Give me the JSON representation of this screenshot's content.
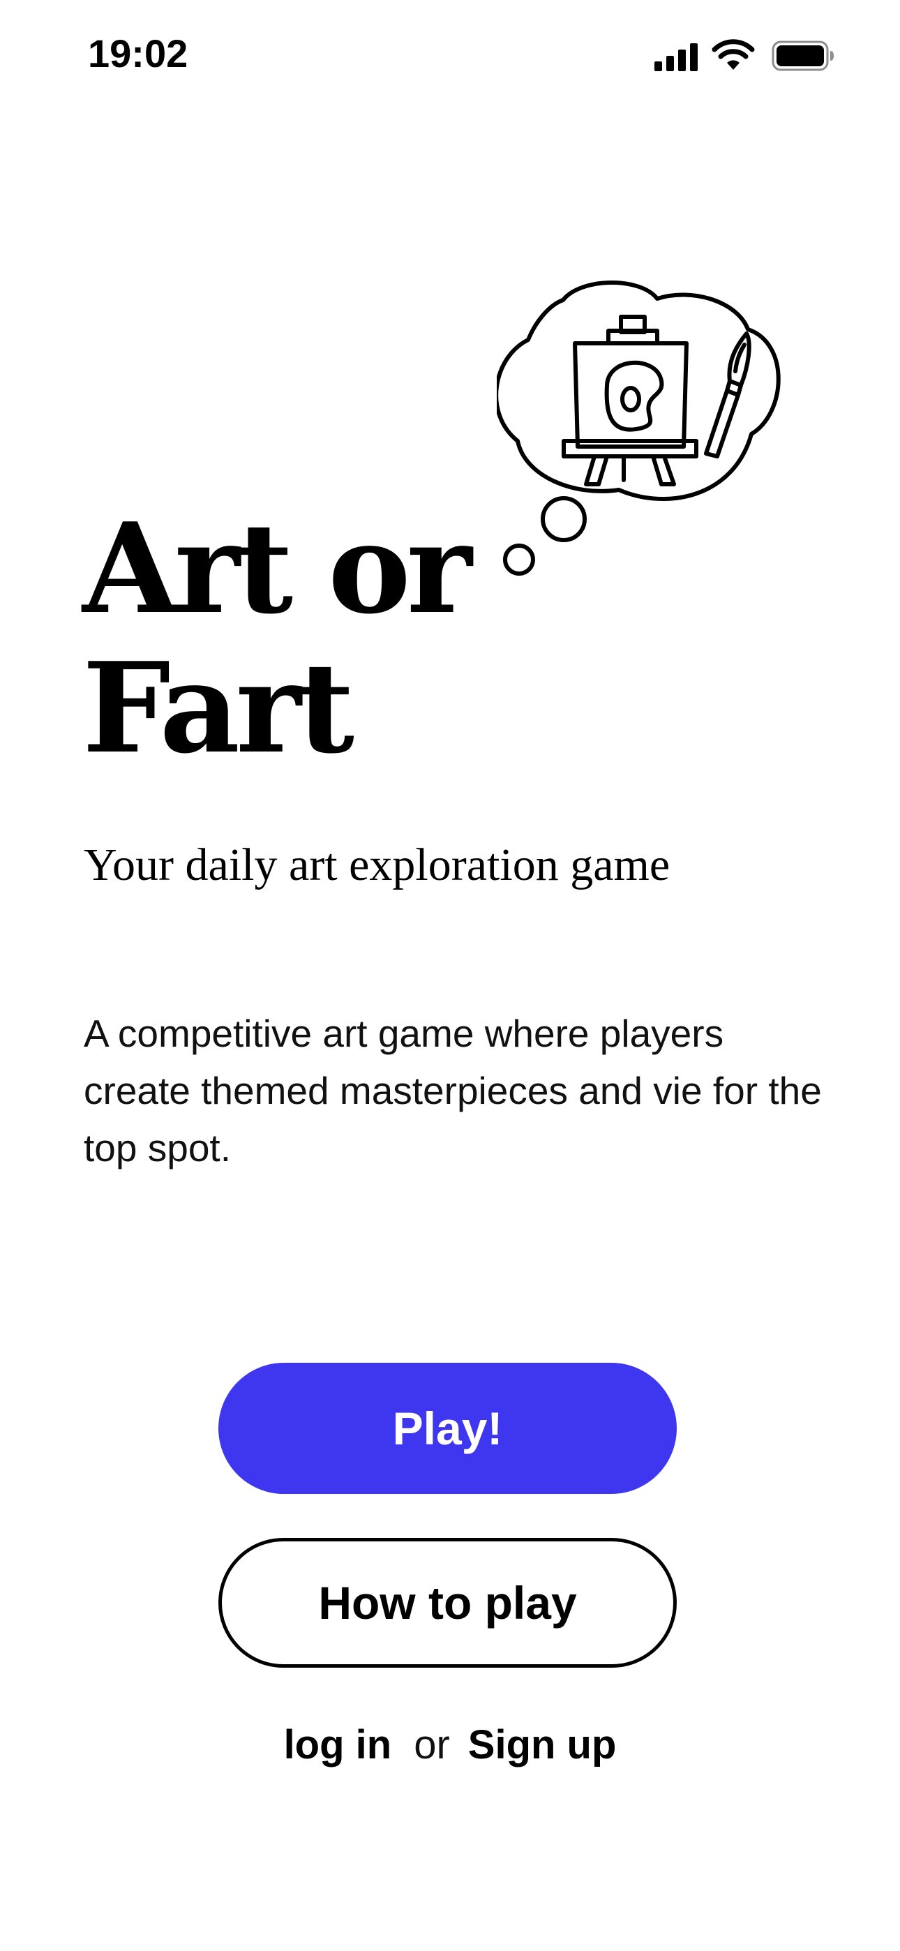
{
  "status_bar": {
    "time": "19:02",
    "icons": [
      "cellular-signal-icon",
      "wifi-icon",
      "battery-icon"
    ]
  },
  "illustration": {
    "name": "thought-bubble-easel-icon",
    "description_icons": [
      "easel-icon",
      "paint-palette-icon",
      "paintbrush-icon"
    ]
  },
  "title": {
    "line1": "Art or",
    "line2": "Fart"
  },
  "tagline": "Your daily art exploration game",
  "description": "A competitive art game where players create themed masterpieces and vie for the top spot.",
  "buttons": {
    "play": "Play!",
    "how_to_play": "How to play"
  },
  "auth": {
    "login": "log in",
    "separator": "or",
    "signup": "Sign up"
  },
  "colors": {
    "accent": "#3f37f0",
    "text": "#000000",
    "background": "#ffffff"
  }
}
